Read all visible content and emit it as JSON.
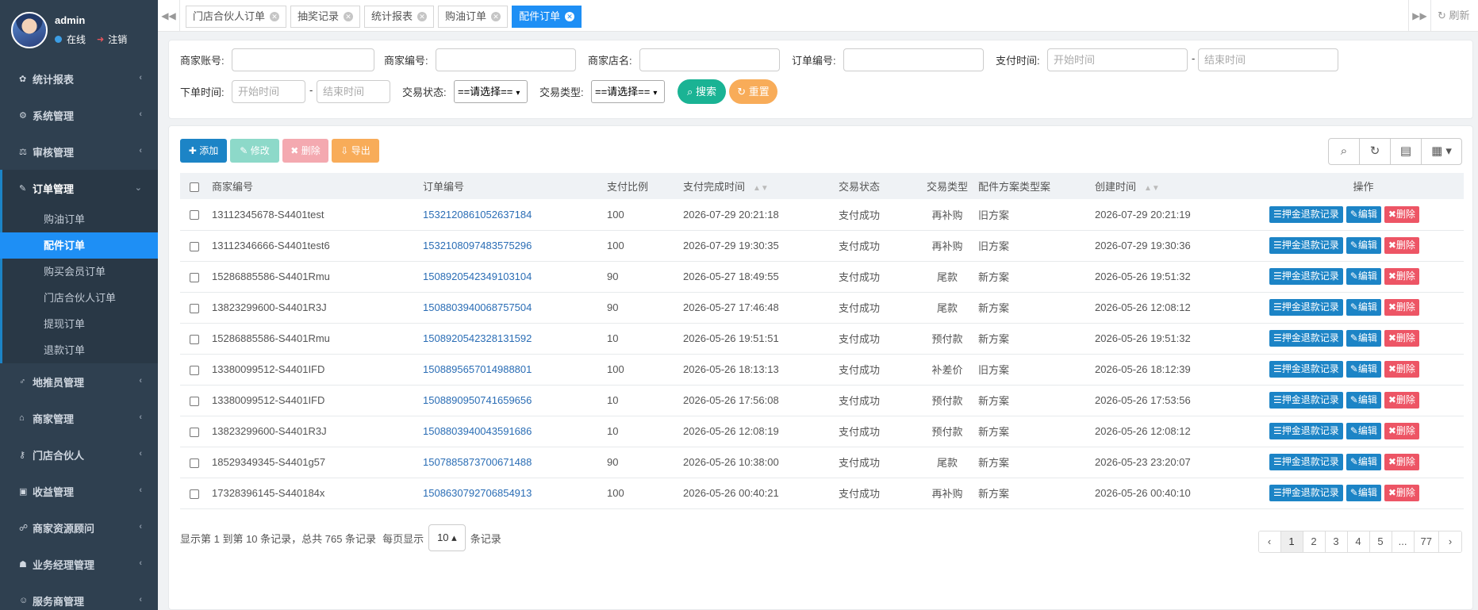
{
  "user": {
    "name": "admin",
    "status": "在线",
    "logout": "注销"
  },
  "sidebar": {
    "items": [
      {
        "label": "统计报表",
        "icon": "gear-icon",
        "glyph": "✿"
      },
      {
        "label": "系统管理",
        "icon": "gear-icon",
        "glyph": "⚙"
      },
      {
        "label": "审核管理",
        "icon": "balance-scale-icon",
        "glyph": "⚖"
      },
      {
        "label": "订单管理",
        "icon": "pin-icon",
        "glyph": "✎"
      },
      {
        "label": "地推员管理",
        "icon": "male-icon",
        "glyph": "♂"
      },
      {
        "label": "商家管理",
        "icon": "bank-icon",
        "glyph": "⌂"
      },
      {
        "label": "门店合伙人",
        "icon": "key-icon",
        "glyph": "⚷"
      },
      {
        "label": "收益管理",
        "icon": "money-icon",
        "glyph": "▣"
      },
      {
        "label": "商家资源顾问",
        "icon": "users-icon",
        "glyph": "☍"
      },
      {
        "label": "业务经理管理",
        "icon": "group-icon",
        "glyph": "☗"
      },
      {
        "label": "服务商管理",
        "icon": "user-icon",
        "glyph": "☺"
      }
    ],
    "submenu": [
      "购油订单",
      "配件订单",
      "购买会员订单",
      "门店合伙人订单",
      "提现订单",
      "退款订单"
    ]
  },
  "tabs": [
    "门店合伙人订单",
    "抽奖记录",
    "统计报表",
    "购油订单",
    "配件订单"
  ],
  "refresh_label": "刷新",
  "search": {
    "merchant_account_label": "商家账号:",
    "merchant_no_label": "商家编号:",
    "store_name_label": "商家店名:",
    "order_no_label": "订单编号:",
    "pay_time_label": "支付时间:",
    "order_time_label": "下单时间:",
    "trade_status_label": "交易状态:",
    "trade_type_label": "交易类型:",
    "start_placeholder": "开始时间",
    "end_placeholder": "结束时间",
    "dash": "-",
    "select_default": "==请选择==",
    "search_btn": "搜索",
    "reset_btn": "重置"
  },
  "toolbar": {
    "add": "添加",
    "edit": "修改",
    "delete": "删除",
    "export": "导出"
  },
  "table": {
    "columns": [
      "商家编号",
      "订单编号",
      "支付比例",
      "支付完成时间",
      "交易状态",
      "交易类型",
      "配件方案类型案",
      "创建时间",
      "操作"
    ],
    "actions": {
      "refund": "押金退款记录",
      "edit": "编辑",
      "delete": "删除"
    },
    "rows": [
      {
        "merchant": "13112345678-S4401test",
        "order": "1532120861052637184",
        "ratio": "100",
        "paid": "2026-07-29 20:21:18",
        "status": "支付成功",
        "type": "再补购",
        "plan": "旧方案",
        "created": "2026-07-29 20:21:19"
      },
      {
        "merchant": "13112346666-S4401test6",
        "order": "1532108097483575296",
        "ratio": "100",
        "paid": "2026-07-29 19:30:35",
        "status": "支付成功",
        "type": "再补购",
        "plan": "旧方案",
        "created": "2026-07-29 19:30:36"
      },
      {
        "merchant": "15286885586-S4401Rmu",
        "order": "1508920542349103104",
        "ratio": "90",
        "paid": "2026-05-27 18:49:55",
        "status": "支付成功",
        "type": "尾款",
        "plan": "新方案",
        "created": "2026-05-26 19:51:32"
      },
      {
        "merchant": "13823299600-S4401R3J",
        "order": "1508803940068757504",
        "ratio": "90",
        "paid": "2026-05-27 17:46:48",
        "status": "支付成功",
        "type": "尾款",
        "plan": "新方案",
        "created": "2026-05-26 12:08:12"
      },
      {
        "merchant": "15286885586-S4401Rmu",
        "order": "1508920542328131592",
        "ratio": "10",
        "paid": "2026-05-26 19:51:51",
        "status": "支付成功",
        "type": "预付款",
        "plan": "新方案",
        "created": "2026-05-26 19:51:32"
      },
      {
        "merchant": "13380099512-S4401IFD",
        "order": "1508895657014988801",
        "ratio": "100",
        "paid": "2026-05-26 18:13:13",
        "status": "支付成功",
        "type": "补差价",
        "plan": "旧方案",
        "created": "2026-05-26 18:12:39"
      },
      {
        "merchant": "13380099512-S4401IFD",
        "order": "1508890950741659656",
        "ratio": "10",
        "paid": "2026-05-26 17:56:08",
        "status": "支付成功",
        "type": "预付款",
        "plan": "新方案",
        "created": "2026-05-26 17:53:56"
      },
      {
        "merchant": "13823299600-S4401R3J",
        "order": "1508803940043591686",
        "ratio": "10",
        "paid": "2026-05-26 12:08:19",
        "status": "支付成功",
        "type": "预付款",
        "plan": "新方案",
        "created": "2026-05-26 12:08:12"
      },
      {
        "merchant": "18529349345-S4401g57",
        "order": "1507885873700671488",
        "ratio": "90",
        "paid": "2026-05-26 10:38:00",
        "status": "支付成功",
        "type": "尾款",
        "plan": "新方案",
        "created": "2026-05-23 23:20:07"
      },
      {
        "merchant": "17328396145-S440184x",
        "order": "1508630792706854913",
        "ratio": "100",
        "paid": "2026-05-26 00:40:21",
        "status": "支付成功",
        "type": "再补购",
        "plan": "新方案",
        "created": "2026-05-26 00:40:10"
      }
    ]
  },
  "pager": {
    "info": "显示第 1 到第 10 条记录，总共 765 条记录",
    "per_page_prefix": "每页显示",
    "page_size": "10",
    "per_page_suffix": "条记录",
    "pages": [
      "‹",
      "1",
      "2",
      "3",
      "4",
      "5",
      "...",
      "77",
      "›"
    ]
  },
  "colors": {
    "sidebar": "#2f4050",
    "primary": "#1c84c6",
    "active_tab": "#1e8ff5",
    "success": "#1ab394",
    "warning": "#f8ac59",
    "danger": "#ed5565"
  }
}
